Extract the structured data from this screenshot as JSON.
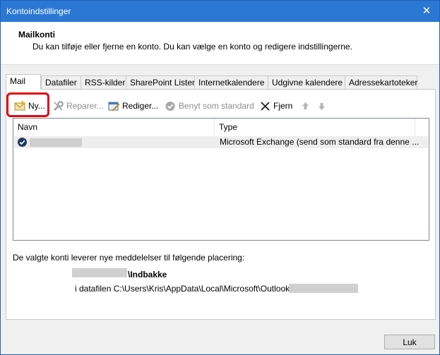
{
  "window": {
    "title": "Kontoindstillinger",
    "close_glyph": "✕"
  },
  "header": {
    "title": "Mailkonti",
    "description": "Du kan tilføje eller fjerne en konto. Du kan vælge en konto og redigere indstillingerne."
  },
  "tabs": [
    {
      "label": "Mail",
      "active": true
    },
    {
      "label": "Datafiler"
    },
    {
      "label": "RSS-kilder"
    },
    {
      "label": "SharePoint Lister"
    },
    {
      "label": "Internetkalendere"
    },
    {
      "label": "Udgivne kalendere"
    },
    {
      "label": "Adressekartoteker"
    }
  ],
  "toolbar": {
    "new_label": "Ny...",
    "repair_label": "Reparer...",
    "edit_label": "Rediger...",
    "default_label": "Benyt som standard",
    "remove_label": "Fjern",
    "move_up_icon": "arrow-up-icon",
    "move_down_icon": "arrow-down-icon"
  },
  "accounts_table": {
    "columns": [
      "Navn",
      "Type"
    ],
    "rows": [
      {
        "name": "",
        "type": "Microsoft Exchange (send som standard fra denne ..."
      }
    ]
  },
  "delivery": {
    "info": "De valgte konti leverer nye meddelelser til følgende placering:",
    "folder_suffix": "\\Indbakke",
    "datafile_prefix": "i datafilen C:\\Users\\Kris\\AppData\\Local\\Microsoft\\Outlook\\"
  },
  "footer": {
    "close_label": "Luk"
  },
  "colors": {
    "titlebar": "#2b78d4",
    "highlight": "#e30613"
  }
}
